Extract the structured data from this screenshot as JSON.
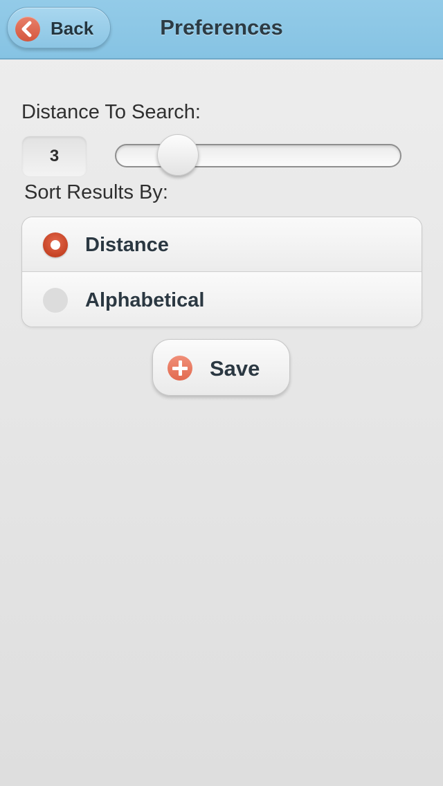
{
  "header": {
    "back_label": "Back",
    "title": "Preferences",
    "back_icon": "chevron-left-icon",
    "bar_color": "#8bc6e5"
  },
  "distance": {
    "label": "Distance To Search:",
    "value": "3",
    "slider_fraction": 0.22
  },
  "sort": {
    "label": "Sort Results By:",
    "options": [
      {
        "label": "Distance",
        "selected": true
      },
      {
        "label": "Alphabetical",
        "selected": false
      }
    ],
    "selected_color": "#d04a2c"
  },
  "save": {
    "label": "Save",
    "icon": "plus-circle-icon"
  }
}
